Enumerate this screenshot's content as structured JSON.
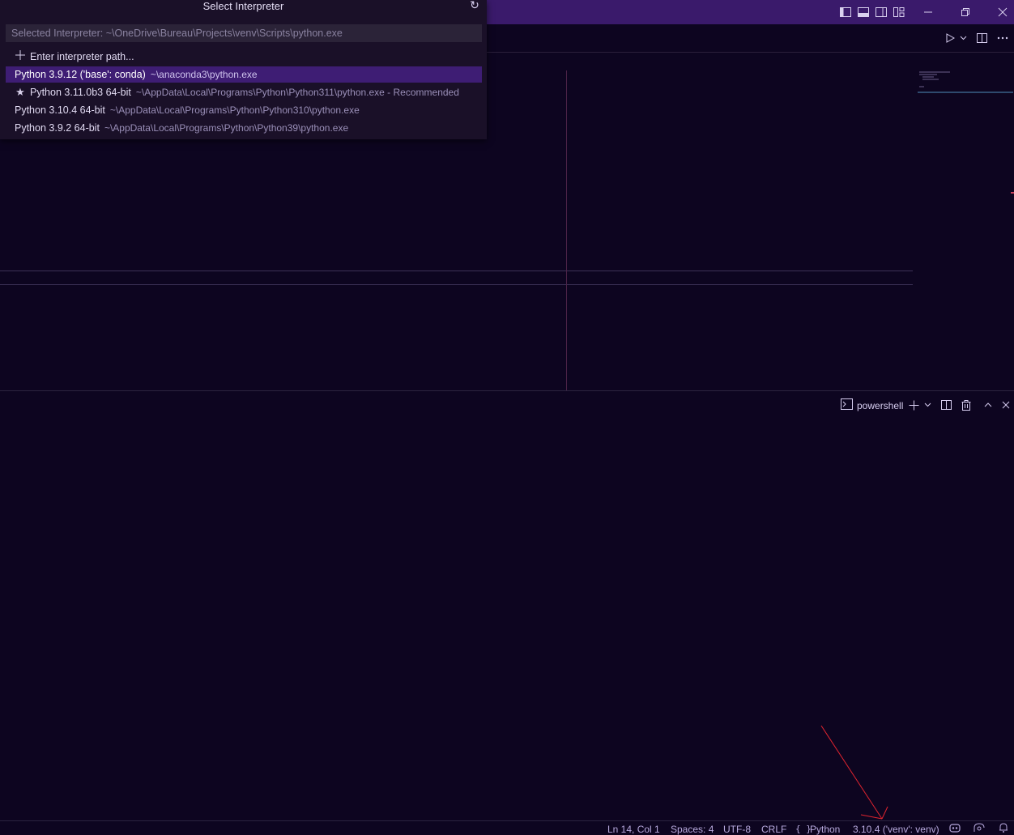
{
  "quick_pick": {
    "title": "Select Interpreter",
    "refresh_icon": "refresh-icon",
    "input_placeholder": "Selected Interpreter: ~\\OneDrive\\Bureau\\Projects\\venv\\Scripts\\python.exe",
    "items": [
      {
        "label": "Enter interpreter path...",
        "description": "",
        "icon": "add-icon",
        "selected": false
      },
      {
        "label": "Python 3.9.12 ('base': conda)",
        "description": "~\\anaconda3\\python.exe",
        "icon": "",
        "selected": true
      },
      {
        "label": "Python 3.11.0b3 64-bit",
        "description": "~\\AppData\\Local\\Programs\\Python\\Python311\\python.exe - Recommended",
        "icon": "star-icon",
        "selected": false
      },
      {
        "label": "Python 3.10.4 64-bit",
        "description": "~\\AppData\\Local\\Programs\\Python\\Python310\\python.exe",
        "icon": "",
        "selected": false
      },
      {
        "label": "Python 3.9.2 64-bit",
        "description": "~\\AppData\\Local\\Programs\\Python\\Python39\\python.exe",
        "icon": "",
        "selected": false
      }
    ]
  },
  "titlebar": {
    "icons": [
      "toggle-primary-sidebar-icon",
      "toggle-panel-icon",
      "toggle-secondary-sidebar-icon",
      "customize-layout-icon",
      "minimize-icon",
      "restore-icon",
      "close-icon"
    ]
  },
  "editor_actions": [
    "run-icon",
    "run-dropdown-icon",
    "split-editor-icon",
    "more-actions-icon"
  ],
  "panel": {
    "terminal_name": "powershell",
    "actions": [
      "new-terminal-icon",
      "terminal-dropdown-icon",
      "split-terminal-icon",
      "kill-terminal-icon",
      "maximize-panel-icon",
      "close-panel-icon"
    ]
  },
  "statusbar": {
    "position": "Ln 14, Col 1",
    "indent": "Spaces: 4",
    "encoding": "UTF-8",
    "eol": "CRLF",
    "language_icon": "{ }",
    "language": "Python",
    "interpreter": "3.10.4 ('venv': venv)",
    "right_icons": [
      "copilot-icon",
      "feedback-icon",
      "notifications-icon"
    ]
  },
  "colors": {
    "titlebar": "#3a1a6b",
    "background": "#0d0520",
    "selection": "#3e1d74",
    "annotation_arrow": "#e0242f"
  }
}
